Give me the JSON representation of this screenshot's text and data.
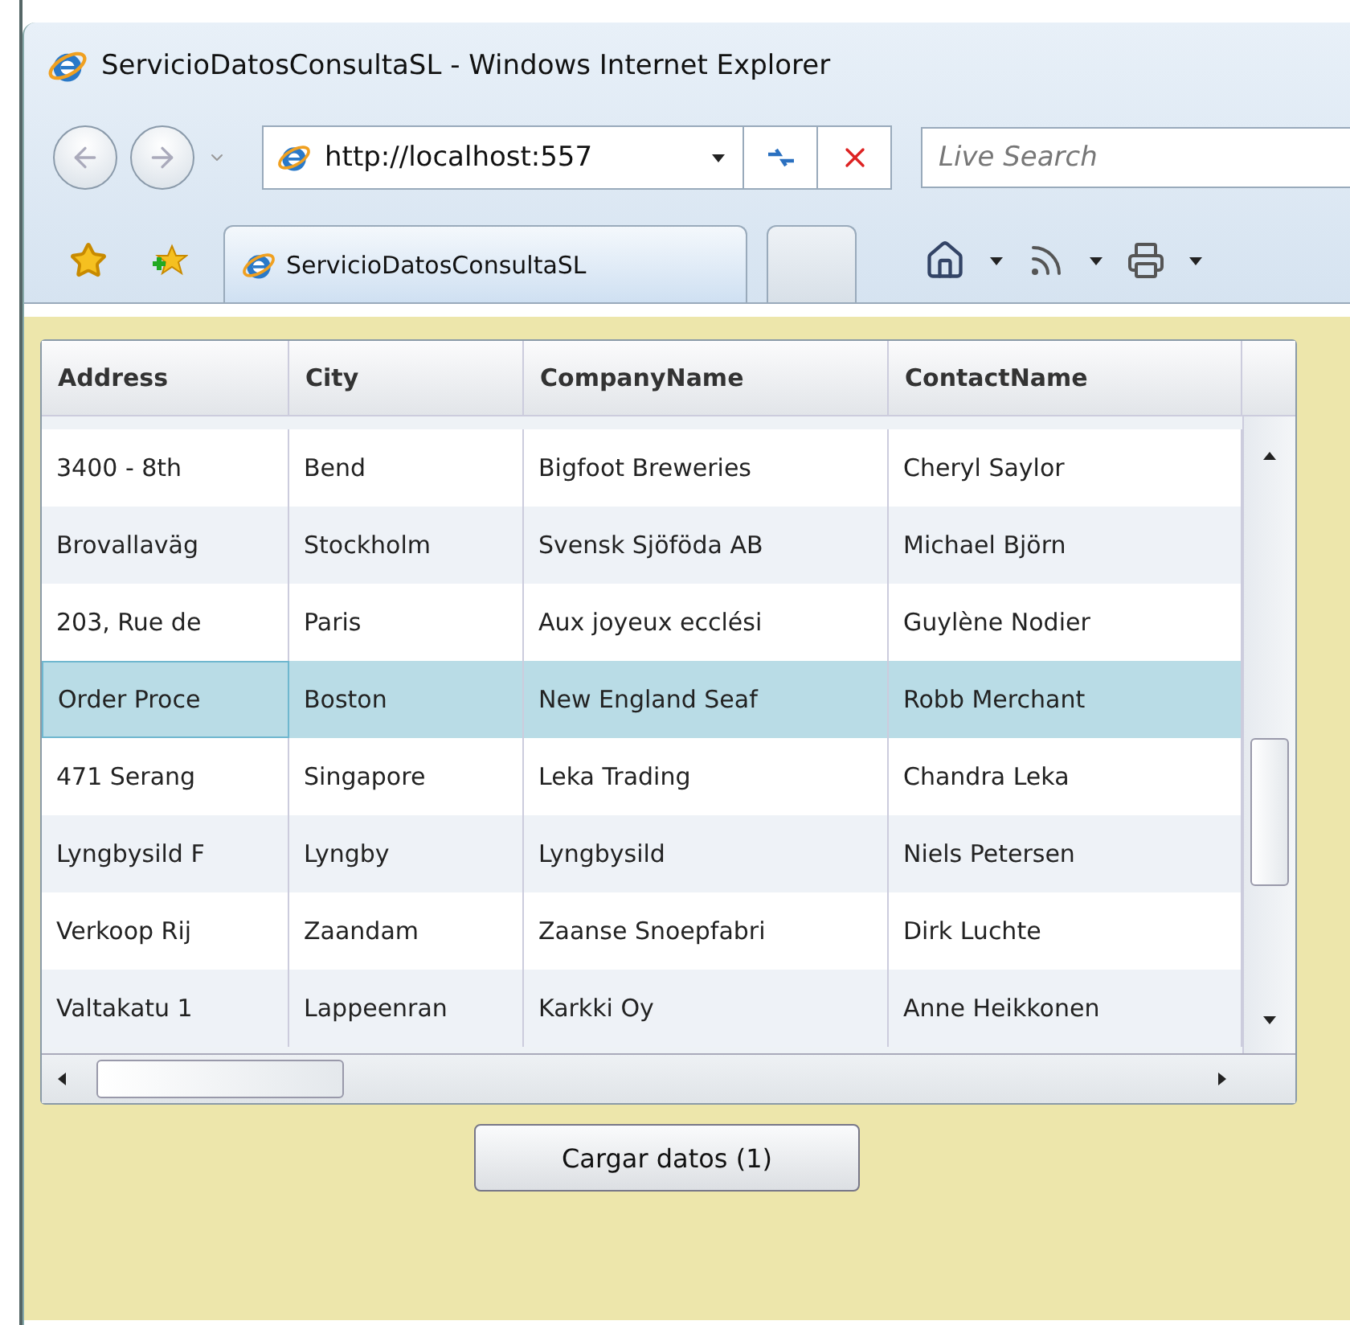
{
  "window": {
    "title": "ServicioDatosConsultaSL - Windows Internet Explorer"
  },
  "address_bar": {
    "value": "http://localhost:557"
  },
  "search": {
    "placeholder": "Live Search"
  },
  "tabs": [
    {
      "label": "ServicioDatosConsultaSL",
      "selected": true
    },
    {
      "selected": false
    }
  ],
  "table": {
    "columns": [
      "Address",
      "City",
      "CompanyName",
      "ContactName"
    ],
    "rows": [
      {
        "cells": [
          "3400 - 8th",
          "Bend",
          "Bigfoot Breweries",
          "Cheryl Saylor"
        ],
        "selected": false
      },
      {
        "cells": [
          "Brovallaväg",
          "Stockholm",
          "Svensk Sjöföda AB",
          "Michael Björn"
        ],
        "selected": false
      },
      {
        "cells": [
          "203, Rue de",
          "Paris",
          "Aux joyeux ecclési",
          "Guylène Nodier"
        ],
        "selected": false
      },
      {
        "cells": [
          "Order Proce",
          "Boston",
          "New England Seaf",
          "Robb Merchant"
        ],
        "selected": true
      },
      {
        "cells": [
          "471 Serang",
          "Singapore",
          "Leka Trading",
          "Chandra Leka"
        ],
        "selected": false
      },
      {
        "cells": [
          "Lyngbysild F",
          "Lyngby",
          "Lyngbysild",
          "Niels Petersen"
        ],
        "selected": false
      },
      {
        "cells": [
          "Verkoop Rij",
          "Zaandam",
          "Zaanse Snoepfabri",
          "Dirk Luchte"
        ],
        "selected": false
      },
      {
        "cells": [
          "Valtakatu 1",
          "Lappeenran",
          "Karkki Oy",
          "Anne Heikkonen"
        ],
        "selected": false
      }
    ]
  },
  "button": {
    "label": "Cargar datos (1)"
  }
}
